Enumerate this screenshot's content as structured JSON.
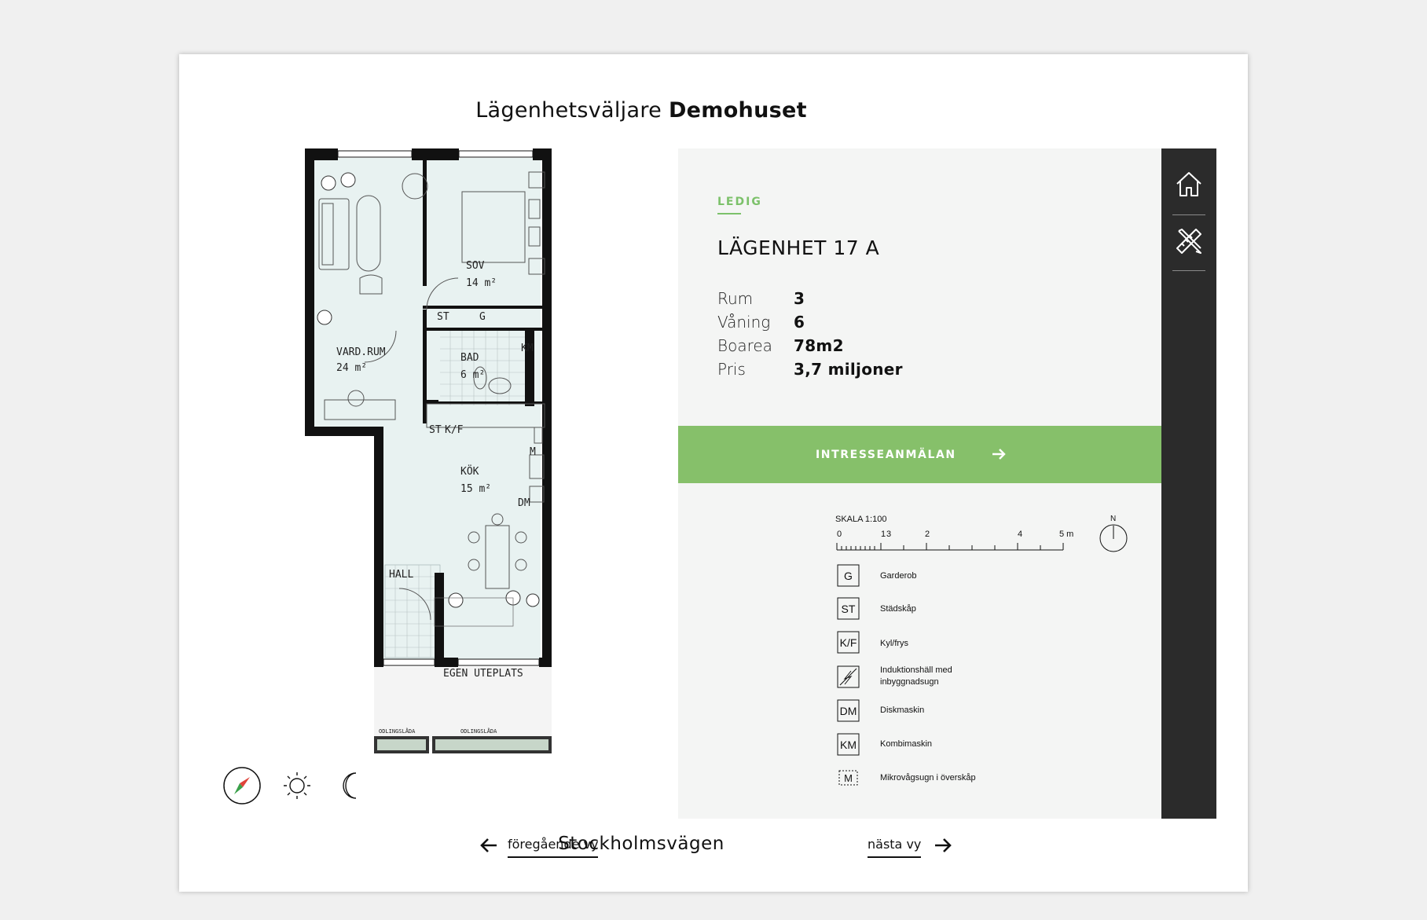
{
  "page": {
    "title_prefix": "Lägenhetsväljare",
    "title_name": "Demohuset"
  },
  "floorplan": {
    "rooms": [
      {
        "name": "VARD.RUM",
        "area": "24 m²"
      },
      {
        "name": "SOV",
        "area": "14 m²"
      },
      {
        "name": "BAD",
        "area": "6 m²"
      },
      {
        "name": "KÖK",
        "area": "15 m²"
      },
      {
        "name": "HALL"
      },
      {
        "name": "EGEN UTEPLATS"
      }
    ],
    "labels": {
      "st": "ST",
      "g": "G",
      "km": "KM",
      "kf": "K/F",
      "m": "M",
      "dm": "DM",
      "odlingslada": "ODLINGSLÅDA"
    }
  },
  "info": {
    "status": "LEDIG",
    "status_color": "#7cc16a",
    "apartment_title": "LÄGENHET 17 A",
    "details": [
      {
        "label": "Rum",
        "value": "3"
      },
      {
        "label": "Våning",
        "value": "6"
      },
      {
        "label": "Boarea",
        "value": "78m2"
      },
      {
        "label": "Pris",
        "value": "3,7 miljoner"
      }
    ],
    "cta_label": "INTRESSEANMÄLAN",
    "cta_color": "#86c06a"
  },
  "legend": {
    "scale_label": "SKALA 1:100",
    "scale_ticks": [
      "0",
      "1",
      "3",
      "2",
      "4",
      "5 m"
    ],
    "north": "N",
    "items": [
      {
        "code": "G",
        "label": "Garderob"
      },
      {
        "code": "ST",
        "label": "Städskåp"
      },
      {
        "code": "K/F",
        "label": "Kyl/frys"
      },
      {
        "code": "induction-icon",
        "label": "Induktionshäll med inbyggnadsugn"
      },
      {
        "code": "DM",
        "label": "Diskmaskin"
      },
      {
        "code": "KM",
        "label": "Kombimaskin"
      },
      {
        "code": "M",
        "label": "Mikrovågsugn i överskåp"
      }
    ]
  },
  "sidebar": {
    "items": [
      {
        "icon": "home-icon"
      },
      {
        "icon": "ruler-pencil-icon"
      }
    ]
  },
  "view_icons": [
    "compass-icon",
    "sun-icon",
    "moon-icon"
  ],
  "nav": {
    "prev_label": "föregående vy",
    "current_view": "Stockholmsvägen",
    "next_label": "nästa vy"
  }
}
